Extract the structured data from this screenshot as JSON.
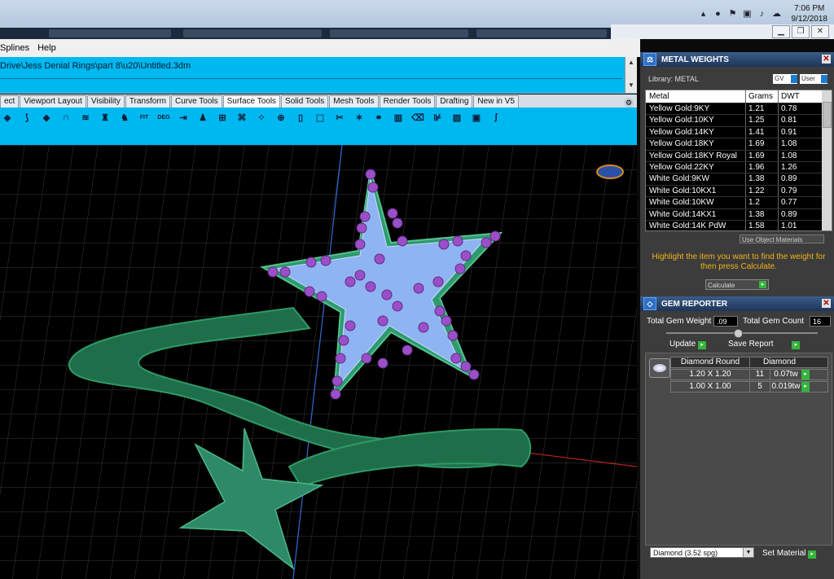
{
  "tray": {
    "time": "7:06 PM",
    "date": "9/12/2018"
  },
  "menu": {
    "items": [
      "Splines",
      "Help"
    ]
  },
  "command": {
    "path": "Drive\\Jess Denial Rings\\part 8\\u20\\Untitled.3dm"
  },
  "tabs": [
    "ect",
    "Viewport Layout",
    "Visibility",
    "Transform",
    "Curve Tools",
    "Surface Tools",
    "Solid Tools",
    "Mesh Tools",
    "Render Tools",
    "Drafting",
    "New in V5"
  ],
  "active_tab": "Surface Tools",
  "toolbar": {
    "labels": [
      "FIT",
      "DEG"
    ]
  },
  "metal_weights": {
    "title": "METAL WEIGHTS",
    "library_label": "Library: METAL",
    "gv": "GV",
    "user": "User",
    "headers": [
      "Metal",
      "Grams",
      "DWT"
    ],
    "rows": [
      [
        "Yellow Gold:9KY",
        "1.21",
        "0.78"
      ],
      [
        "Yellow Gold:10KY",
        "1.25",
        "0.81"
      ],
      [
        "Yellow Gold:14KY",
        "1.41",
        "0.91"
      ],
      [
        "Yellow Gold:18KY",
        "1.69",
        "1.08"
      ],
      [
        "Yellow Gold:18KY Royal",
        "1.69",
        "1.08"
      ],
      [
        "Yellow Gold:22KY",
        "1.96",
        "1.26"
      ],
      [
        "White Gold:9KW",
        "1.38",
        "0.89"
      ],
      [
        "White Gold:10KX1",
        "1.22",
        "0.79"
      ],
      [
        "White Gold:10KW",
        "1.2",
        "0.77"
      ],
      [
        "White Gold:14KX1",
        "1.38",
        "0.89"
      ],
      [
        "White Gold:14K PdW",
        "1.58",
        "1.01"
      ]
    ],
    "use_object_materials": "Use Object Materials",
    "hint": "Highlight the item you want to find the weight for then press Calculate.",
    "calculate": "Calculate"
  },
  "gem_reporter": {
    "title": "GEM REPORTER",
    "total_weight_label": "Total Gem Weight",
    "total_weight": ".09",
    "total_count_label": "Total Gem Count",
    "total_count": "16",
    "update": "Update",
    "save_report": "Save Report",
    "gem_headers": [
      "Diamond Round",
      "Diamond"
    ],
    "gem_rows": [
      [
        "1.20 X 1.20",
        "11",
        "0.07tw"
      ],
      [
        "1.00 X 1.00",
        "5",
        "0.019tw"
      ]
    ],
    "material_select": "Diamond    (3.52 spg)",
    "set_material": "Set Material"
  }
}
